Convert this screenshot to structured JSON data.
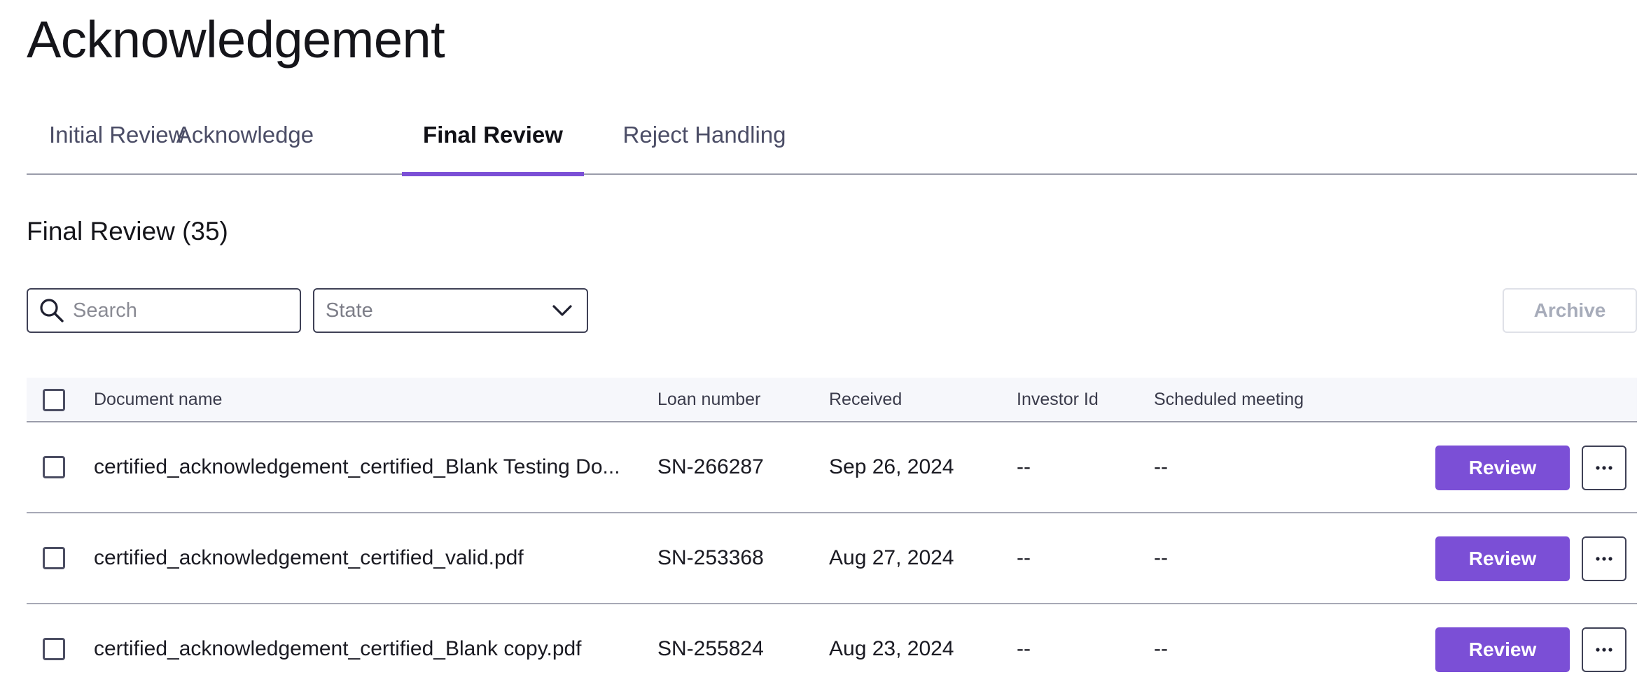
{
  "page": {
    "title": "Acknowledgement"
  },
  "tabs": [
    {
      "label": "Initial Review",
      "active": false
    },
    {
      "label": "Acknowledge",
      "active": false
    },
    {
      "label": "Final Review",
      "active": true
    },
    {
      "label": "Reject Handling",
      "active": false
    }
  ],
  "section": {
    "title": "Final Review (35)"
  },
  "filters": {
    "search_placeholder": "Search",
    "search_value": "",
    "state_label": "State",
    "archive_label": "Archive"
  },
  "table": {
    "columns": {
      "document_name": "Document name",
      "loan_number": "Loan number",
      "received": "Received",
      "investor_id": "Investor Id",
      "scheduled_meeting": "Scheduled meeting"
    },
    "rows": [
      {
        "document_name": "certified_acknowledgement_certified_Blank Testing Do...",
        "loan_number": "SN-266287",
        "received": "Sep 26, 2024",
        "investor_id": "--",
        "scheduled_meeting": "--",
        "action_label": "Review"
      },
      {
        "document_name": "certified_acknowledgement_certified_valid.pdf",
        "loan_number": "SN-253368",
        "received": "Aug 27, 2024",
        "investor_id": "--",
        "scheduled_meeting": "--",
        "action_label": "Review"
      },
      {
        "document_name": "certified_acknowledgement_certified_Blank copy.pdf",
        "loan_number": "SN-255824",
        "received": "Aug 23, 2024",
        "investor_id": "--",
        "scheduled_meeting": "--",
        "action_label": "Review"
      }
    ]
  },
  "colors": {
    "accent": "#7b4fd6",
    "border": "#3f4156",
    "header_bg": "#f6f7fb",
    "disabled_text": "#a7acba"
  },
  "icons": {
    "search": "search-icon",
    "state_dropdown": "chevron-down-icon",
    "row_menu": "more-horizontal-icon"
  }
}
